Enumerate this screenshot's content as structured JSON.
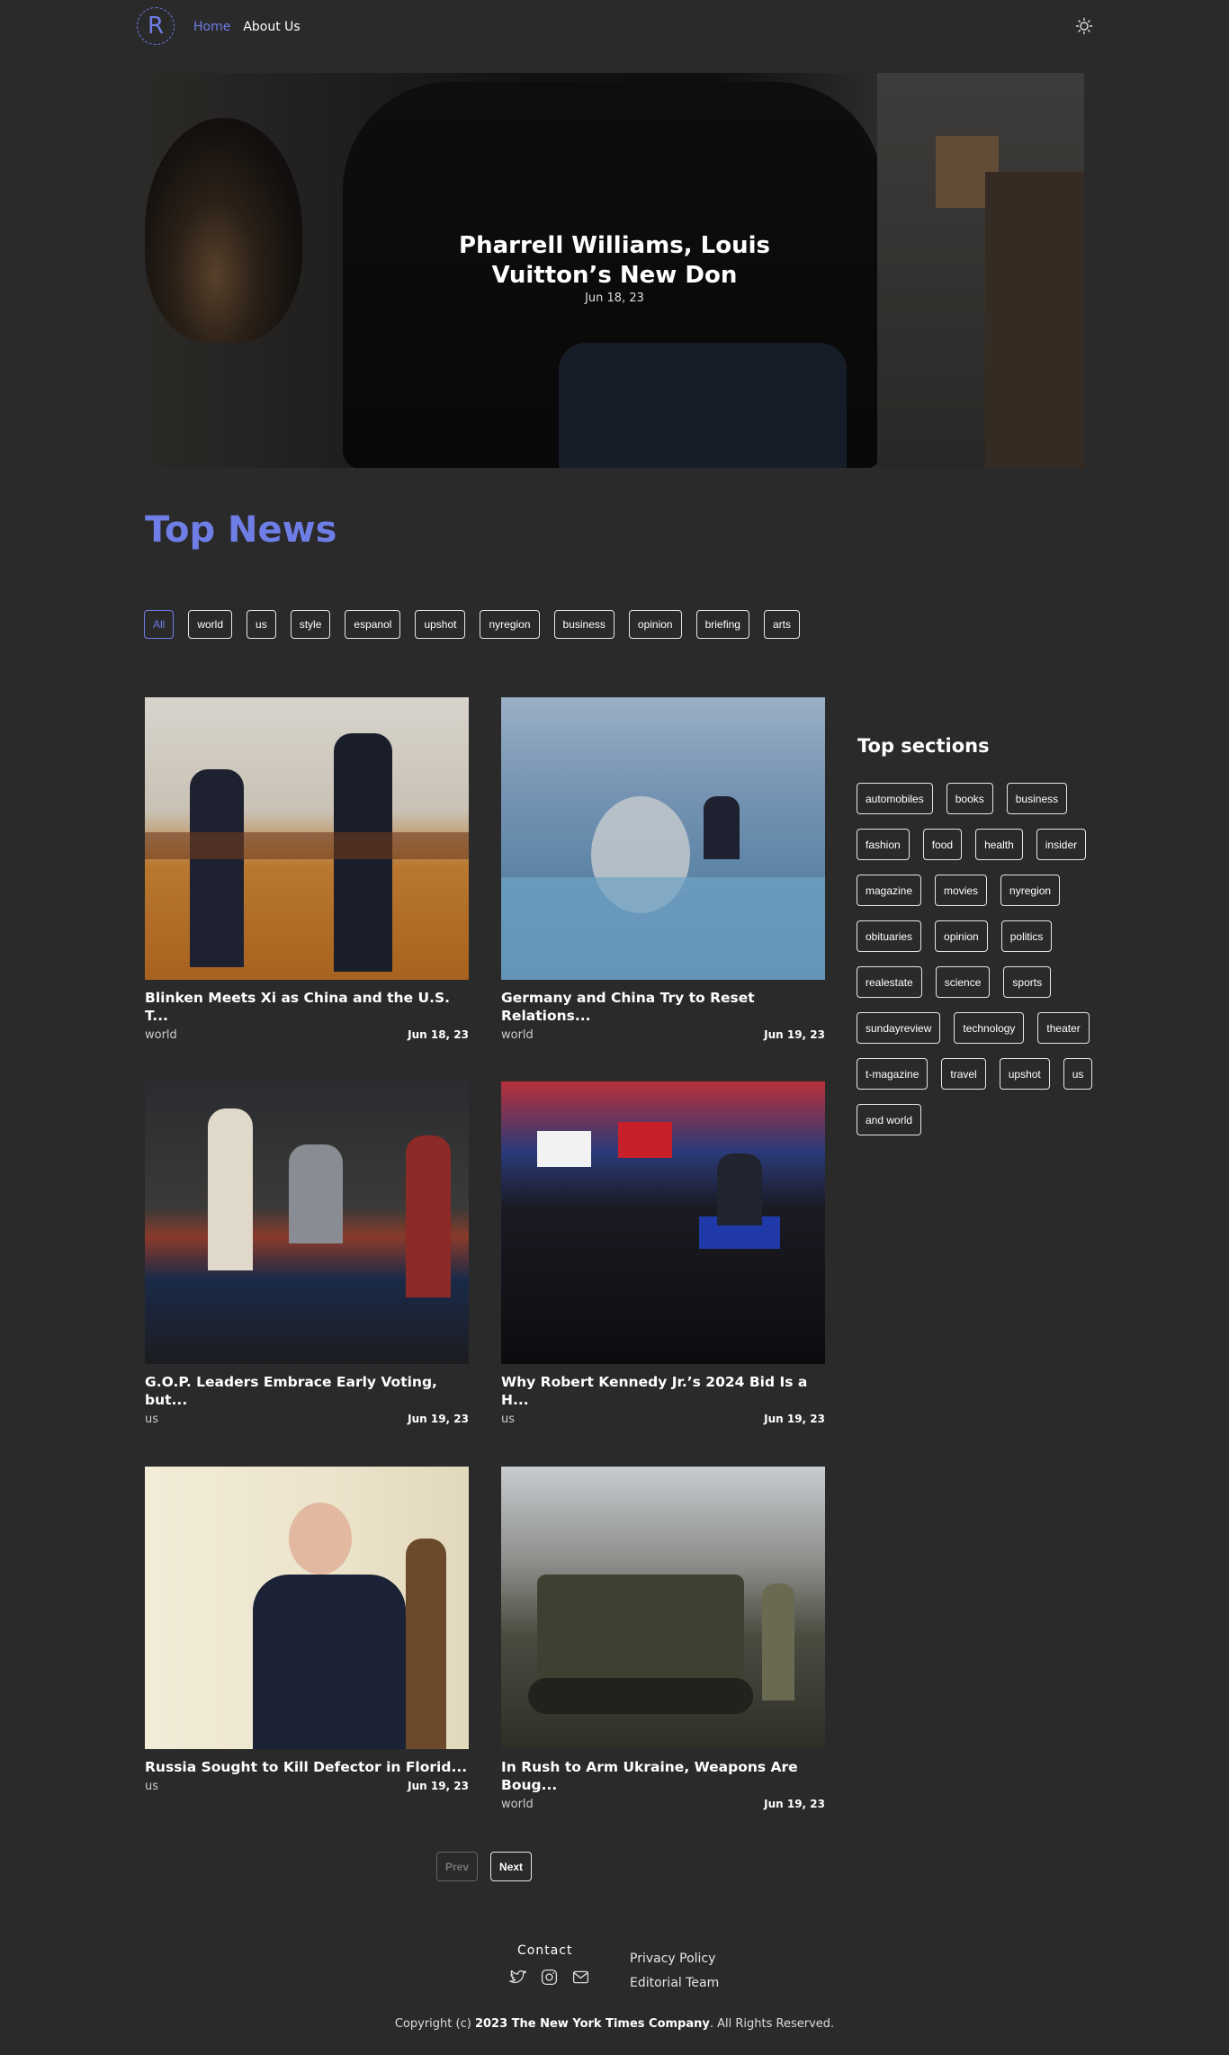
{
  "brand": {
    "logo_letter": "R"
  },
  "nav": {
    "home": "Home",
    "about": "About Us"
  },
  "hero": {
    "title_line1": "Pharrell Williams, Louis",
    "title_line2": "Vuitton’s New Don",
    "date": "Jun 18, 23"
  },
  "section_title": "Top News",
  "filters": [
    "All",
    "world",
    "us",
    "style",
    "espanol",
    "upshot",
    "nyregion",
    "business",
    "opinion",
    "briefing",
    "arts"
  ],
  "articles": [
    {
      "title": "Blinken Meets Xi as China and the U.S. T...",
      "category": "world",
      "date": "Jun 18, 23"
    },
    {
      "title": "Germany and China Try to Reset Relations...",
      "category": "world",
      "date": "Jun 19, 23"
    },
    {
      "title": "G.O.P. Leaders Embrace Early Voting, but...",
      "category": "us",
      "date": "Jun 19, 23"
    },
    {
      "title": "Why Robert Kennedy Jr.’s 2024 Bid Is a H...",
      "category": "us",
      "date": "Jun 19, 23"
    },
    {
      "title": "Russia Sought to Kill Defector in Florid...",
      "category": "us",
      "date": "Jun 19, 23"
    },
    {
      "title": "In Rush to Arm Ukraine, Weapons Are Boug...",
      "category": "world",
      "date": "Jun 19, 23"
    }
  ],
  "sidebar": {
    "title": "Top sections",
    "sections": [
      "automobiles",
      "books",
      "business",
      "fashion",
      "food",
      "health",
      "insider",
      "magazine",
      "movies",
      "nyregion",
      "obituaries",
      "opinion",
      "politics",
      "realestate",
      "science",
      "sports",
      "sundayreview",
      "technology",
      "theater",
      "t-magazine",
      "travel",
      "upshot",
      "us",
      "and world"
    ]
  },
  "pager": {
    "prev": "Prev",
    "next": "Next"
  },
  "footer": {
    "contact": "Contact",
    "privacy": "Privacy Policy",
    "editorial": "Editorial Team",
    "copyright_prefix": "Copyright (c)",
    "copyright_company": "2023 The New York Times Company",
    "copyright_suffix": ". All Rights Reserved."
  },
  "icons": {
    "theme": "sun-icon",
    "social": [
      "twitter-icon",
      "instagram-icon",
      "mail-icon"
    ]
  },
  "colors": {
    "accent": "#6e7ee6",
    "background": "#2a2a2b"
  }
}
